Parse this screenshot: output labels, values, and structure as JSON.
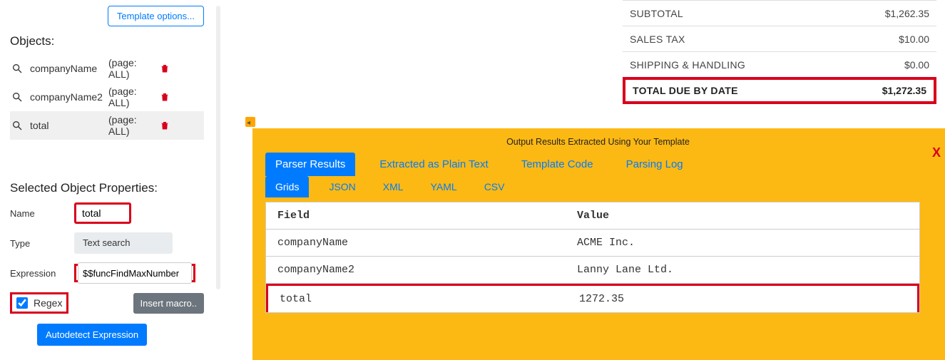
{
  "left": {
    "template_options_label": "Template options...",
    "objects_title": "Objects:",
    "objects": [
      {
        "name": "companyName",
        "page": "(page: ALL)",
        "selected": false
      },
      {
        "name": "companyName2",
        "page": "(page: ALL)",
        "selected": false
      },
      {
        "name": "total",
        "page": "(page: ALL)",
        "selected": true
      }
    ],
    "props_title": "Selected Object Properties:",
    "name_label": "Name",
    "name_value": "total",
    "type_label": "Type",
    "type_value": "Text search",
    "expression_label": "Expression",
    "expression_value": "$$funcFindMaxNumber",
    "regex_label": "Regex",
    "regex_checked": true,
    "insert_macro_label": "Insert macro..",
    "autodetect_label": "Autodetect Expression"
  },
  "invoice": {
    "rows": [
      {
        "label": "SUBTOTAL",
        "value": "$1,262.35"
      },
      {
        "label": "SALES TAX",
        "value": "$10.00"
      },
      {
        "label": "SHIPPING & HANDLING",
        "value": "$0.00"
      },
      {
        "label": "TOTAL DUE BY DATE",
        "value": "$1,272.35"
      }
    ]
  },
  "output": {
    "title": "Output Results Extracted Using Your Template",
    "tabs": [
      "Parser Results",
      "Extracted as Plain Text",
      "Template Code",
      "Parsing Log"
    ],
    "active_tab": "Parser Results",
    "subtabs": [
      "Grids",
      "JSON",
      "XML",
      "YAML",
      "CSV"
    ],
    "active_subtab": "Grids",
    "table": {
      "field_header": "Field",
      "value_header": "Value",
      "rows": [
        {
          "field": "companyName",
          "value": "ACME Inc."
        },
        {
          "field": "companyName2",
          "value": "Lanny Lane Ltd."
        },
        {
          "field": "total",
          "value": "1272.35"
        }
      ]
    }
  }
}
